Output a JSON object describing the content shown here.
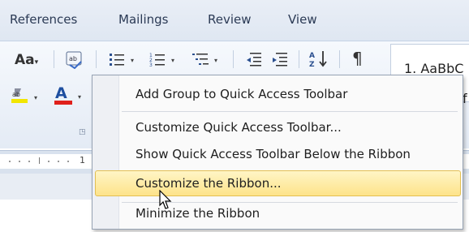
{
  "tabs": [
    "References",
    "Mailings",
    "Review",
    "View"
  ],
  "ribbon": {
    "font_button": "Aa",
    "style_preview": "1. AaBbC",
    "style_preview_2": "f",
    "ruler_number": "1"
  },
  "context_menu": {
    "items": [
      "Add Group to Quick Access Toolbar",
      "Customize Quick Access Toolbar...",
      "Show Quick Access Toolbar Below the Ribbon",
      "Customize the Ribbon...",
      "Minimize the Ribbon"
    ],
    "highlighted_index": 3
  },
  "colors": {
    "highlight_fill": "#fde38a",
    "font_color_red": "#e0201b",
    "text_highlight_yellow": "#f2e600"
  },
  "icons": [
    "change-case-icon",
    "show-hide-paragraph-icon",
    "bullets-icon",
    "numbering-icon",
    "multilevel-list-icon",
    "decrease-indent-icon",
    "increase-indent-icon",
    "sort-icon",
    "pilcrow-icon",
    "text-highlight-icon",
    "font-color-icon",
    "mouse-cursor-icon"
  ]
}
